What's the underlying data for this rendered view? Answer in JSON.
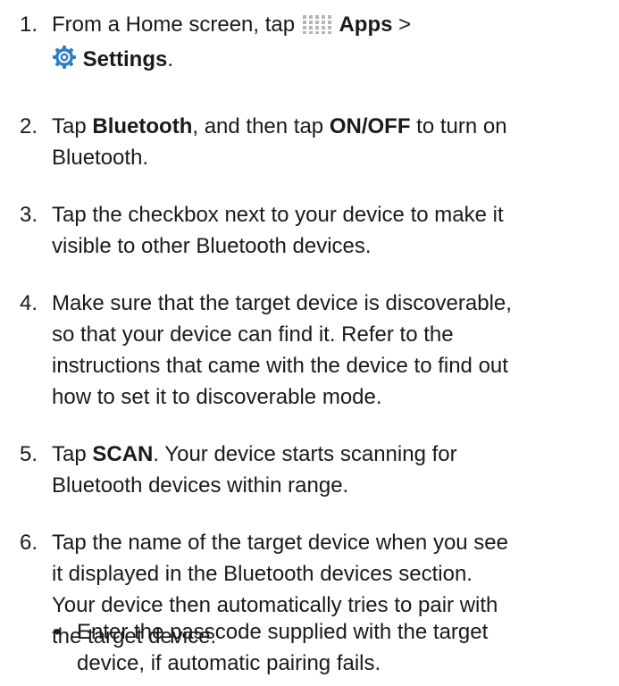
{
  "steps": [
    {
      "number": "1.",
      "line1_pre": "From a Home screen, tap",
      "apps_label": "Apps",
      "line1_sep": ">",
      "settings_label": "Settings",
      "settings_post": "."
    },
    {
      "number": "2.",
      "pre": "Tap ",
      "bluetooth_label": "Bluetooth",
      "mid": ", and then tap ",
      "onoff_label": "ON/OFF",
      "post": " to turn on",
      "line2": "Bluetooth."
    },
    {
      "number": "3.",
      "lines": [
        "Tap the checkbox next to your device to make it",
        "visible to other Bluetooth devices."
      ]
    },
    {
      "number": "4.",
      "lines": [
        "Make sure that the target device is discoverable,",
        "so that your device can find it. Refer to the",
        "instructions that came with the device to find out",
        "how to set it to discoverable mode."
      ]
    },
    {
      "number": "5.",
      "pre": "Tap ",
      "scan_label": "SCAN",
      "post": ". Your device starts scanning for",
      "line2": "Bluetooth devices within range."
    },
    {
      "number": "6.",
      "lines": [
        "Tap the name of the target device when you see",
        "it displayed in the Bluetooth devices section.",
        "Your device then automatically tries to pair with",
        "the target device."
      ]
    }
  ],
  "bullet": {
    "symbol": "•",
    "lines": [
      "Enter the passcode supplied with the target",
      "device, if automatic pairing fails."
    ]
  },
  "icons": {
    "apps": "apps-grid-icon",
    "settings": "settings-gear-icon"
  },
  "colors": {
    "text": "#1a1a1a",
    "icon_blue": "#2f7fc4",
    "icon_dots": "#b5b5b5"
  }
}
